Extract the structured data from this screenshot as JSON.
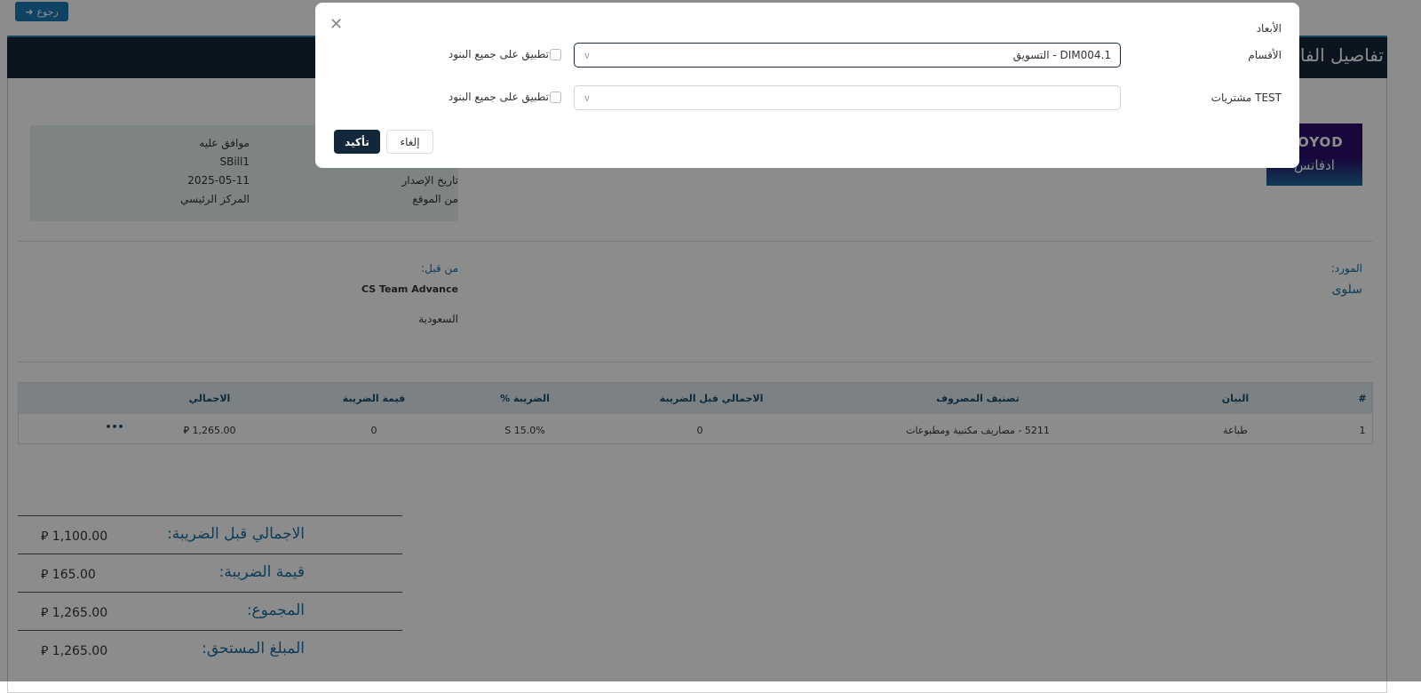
{
  "back_button": {
    "label": "رجوع",
    "icon": "arrow-right-icon"
  },
  "card": {
    "title": "تفاصيل الفاتورة"
  },
  "logo": {
    "line1": "QOYOD",
    "line2": "ادفانس"
  },
  "info": {
    "rows": [
      {
        "label": "",
        "value": "موافق عليه"
      },
      {
        "label": "",
        "value": "SBill1"
      },
      {
        "label": "تاريخ الإصدار",
        "value": "2025-05-11"
      },
      {
        "label": "من الموقع",
        "value": "المركز الرئيسي"
      }
    ]
  },
  "supplier": {
    "label": "المورد:",
    "value": "سلوى"
  },
  "created_by": {
    "label": "من قبل:",
    "value": "CS Team Advance",
    "country": "السعودية"
  },
  "table": {
    "headers": [
      "#",
      "البيان",
      "تصنيف المصروف",
      "الاجمالي قبل الضريبة",
      "الضريبة %",
      "قيمة الضريبة",
      "الاجمالي"
    ],
    "rows": [
      [
        "1",
        "طباعة",
        "5211 - مصاريف مكتبية ومطبوعات",
        "0",
        "S 15.0%",
        "0",
        "⃁ 1,265.00"
      ]
    ],
    "actions_icon": "more-horizontal-icon"
  },
  "totals": [
    {
      "label": "الاجمالي قبل الضريبة:",
      "value": "1,100.00"
    },
    {
      "label": "قيمة الضريبة:",
      "value": "165.00"
    },
    {
      "label": "المجموع:",
      "value": "1,265.00"
    },
    {
      "label": "المبلغ المستحق:",
      "value": "1,265.00"
    }
  ],
  "currency_symbol": "⃁",
  "modal": {
    "title": "الأبعاد",
    "fields": [
      {
        "label": "الأقسام",
        "value": "DIM004.1 - التسويق",
        "apply_all": "تطبيق على جميع البنود",
        "apply_checked": false
      },
      {
        "label": "TEST مشتريات",
        "value": "",
        "apply_all": "تطبيق على جميع البنود",
        "apply_checked": false
      }
    ],
    "cancel": "إلغاء",
    "confirm": "تأكيد"
  }
}
